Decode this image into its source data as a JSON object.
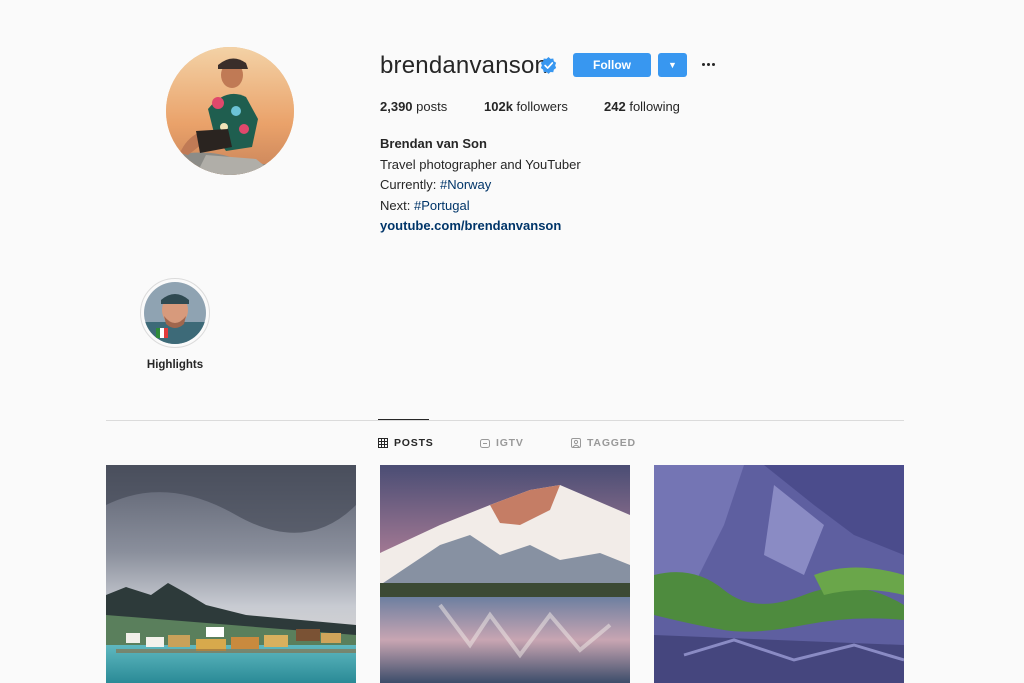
{
  "profile": {
    "username": "brendanvanson",
    "follow_label": "Follow",
    "dropdown_icon": "caret-down-icon",
    "more_icon": "more-horizontal-icon",
    "verified_icon": "verified-badge-icon",
    "stats": {
      "posts_count": "2,390",
      "posts_label": "posts",
      "followers_count": "102k",
      "followers_label": "followers",
      "following_count": "242",
      "following_label": "following"
    },
    "bio": {
      "name": "Brendan van Son",
      "line1": "Travel photographer and YouTuber",
      "line2_prefix": "Currently:",
      "line2_tag": "#Norway",
      "line3_prefix": "Next:",
      "line3_tag": "#Portugal",
      "link": "youtube.com/brendanvanson"
    }
  },
  "highlights": [
    {
      "label": "Highlights"
    }
  ],
  "tabs": [
    {
      "label": "POSTS",
      "icon": "grid-icon",
      "active": true
    },
    {
      "label": "IGTV",
      "icon": "igtv-icon",
      "active": false
    },
    {
      "label": "TAGGED",
      "icon": "tagged-icon",
      "active": false
    }
  ],
  "posts": [
    {
      "subject": "coastal village under stormy sky"
    },
    {
      "subject": "snowy mountain reflected in lake"
    },
    {
      "subject": "purple rock cliff with green moss"
    }
  ],
  "colors": {
    "accent": "#3897f0",
    "link": "#003569",
    "background": "#fafafa",
    "text": "#262626",
    "muted": "#999999",
    "divider": "#dbdbdb"
  }
}
